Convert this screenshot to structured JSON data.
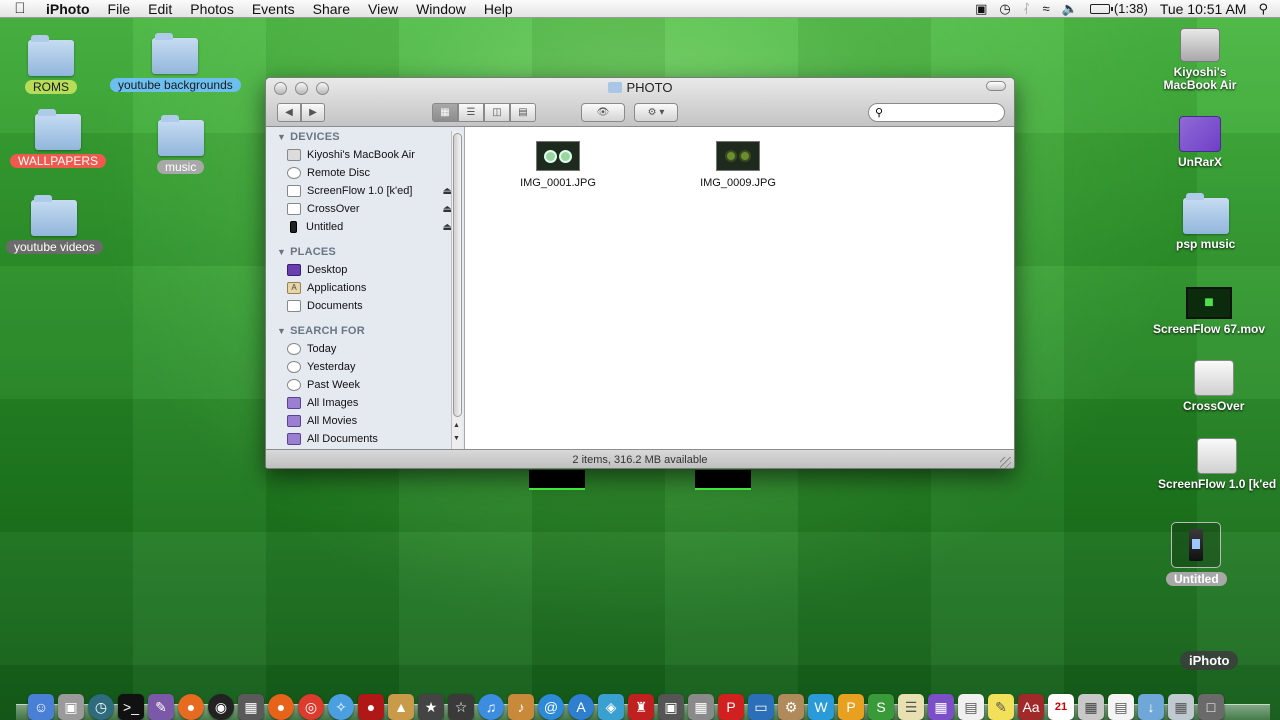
{
  "menubar": {
    "app_name": "iPhoto",
    "menus": [
      "File",
      "Edit",
      "Photos",
      "Events",
      "Share",
      "View",
      "Window",
      "Help"
    ],
    "battery_text": "(1:38)",
    "clock": "Tue 10:51 AM"
  },
  "desktop_icons": {
    "roms": "ROMS",
    "youtube_backgrounds": "youtube backgrounds",
    "wallpapers": "WALLPAPERS",
    "music": "music",
    "youtube_videos": "youtube videos",
    "macbook": "Kiyoshi's MacBook Air",
    "unrarx": "UnRarX",
    "psp_music": "psp music",
    "screenflow_mov": "ScreenFlow 67.mov",
    "crossover": "CrossOver",
    "screenflow_disk": "ScreenFlow 1.0 [k'ed",
    "untitled": "Untitled"
  },
  "finder": {
    "title": "PHOTO",
    "search_placeholder": "",
    "sections": {
      "devices": "DEVICES",
      "places": "PLACES",
      "search_for": "SEARCH FOR"
    },
    "devices": [
      "Kiyoshi's MacBook Air",
      "Remote Disc",
      "ScreenFlow 1.0 [k'ed]",
      "CrossOver",
      "Untitled"
    ],
    "places": [
      "Desktop",
      "Applications",
      "Documents"
    ],
    "search_for": [
      "Today",
      "Yesterday",
      "Past Week",
      "All Images",
      "All Movies",
      "All Documents"
    ],
    "files": [
      "IMG_0001.JPG",
      "IMG_0009.JPG"
    ],
    "status": "2 items, 316.2 MB available"
  },
  "tooltip": "iPhoto",
  "colors": {
    "desktop_green": "#2f9a2c",
    "sidebar_bg": "#e5eaf1",
    "label_green": "#b6dc58",
    "label_blue": "#6dbff0",
    "label_red": "#f05a4e"
  },
  "dock_items": [
    "finder-icon",
    "preview-icon",
    "time-machine-icon",
    "terminal-icon",
    "script-editor-icon",
    "firefox-icon",
    "dashboard-icon",
    "expose-icon",
    "firefox-icon",
    "chrome-icon",
    "safari-icon",
    "photobooth-icon",
    "iphoto-icon",
    "imovie-icon",
    "star-icon",
    "itunes-icon",
    "garageband-icon",
    "mail-icon",
    "app-store-icon",
    "network-icon",
    "chess-icon",
    "photo-browser-icon",
    "preview-icon",
    "pj-icon",
    "keynote-icon",
    "automator-icon",
    "w-icon",
    "p-icon",
    "s-icon",
    "notes-icon",
    "stack-icon",
    "document-icon",
    "stickies-icon",
    "dictionary-icon",
    "calendar-icon",
    "calculator-icon",
    "document-icon",
    "downloads-icon",
    "folder-icon",
    "trash-icon"
  ],
  "calendar_day": "21"
}
